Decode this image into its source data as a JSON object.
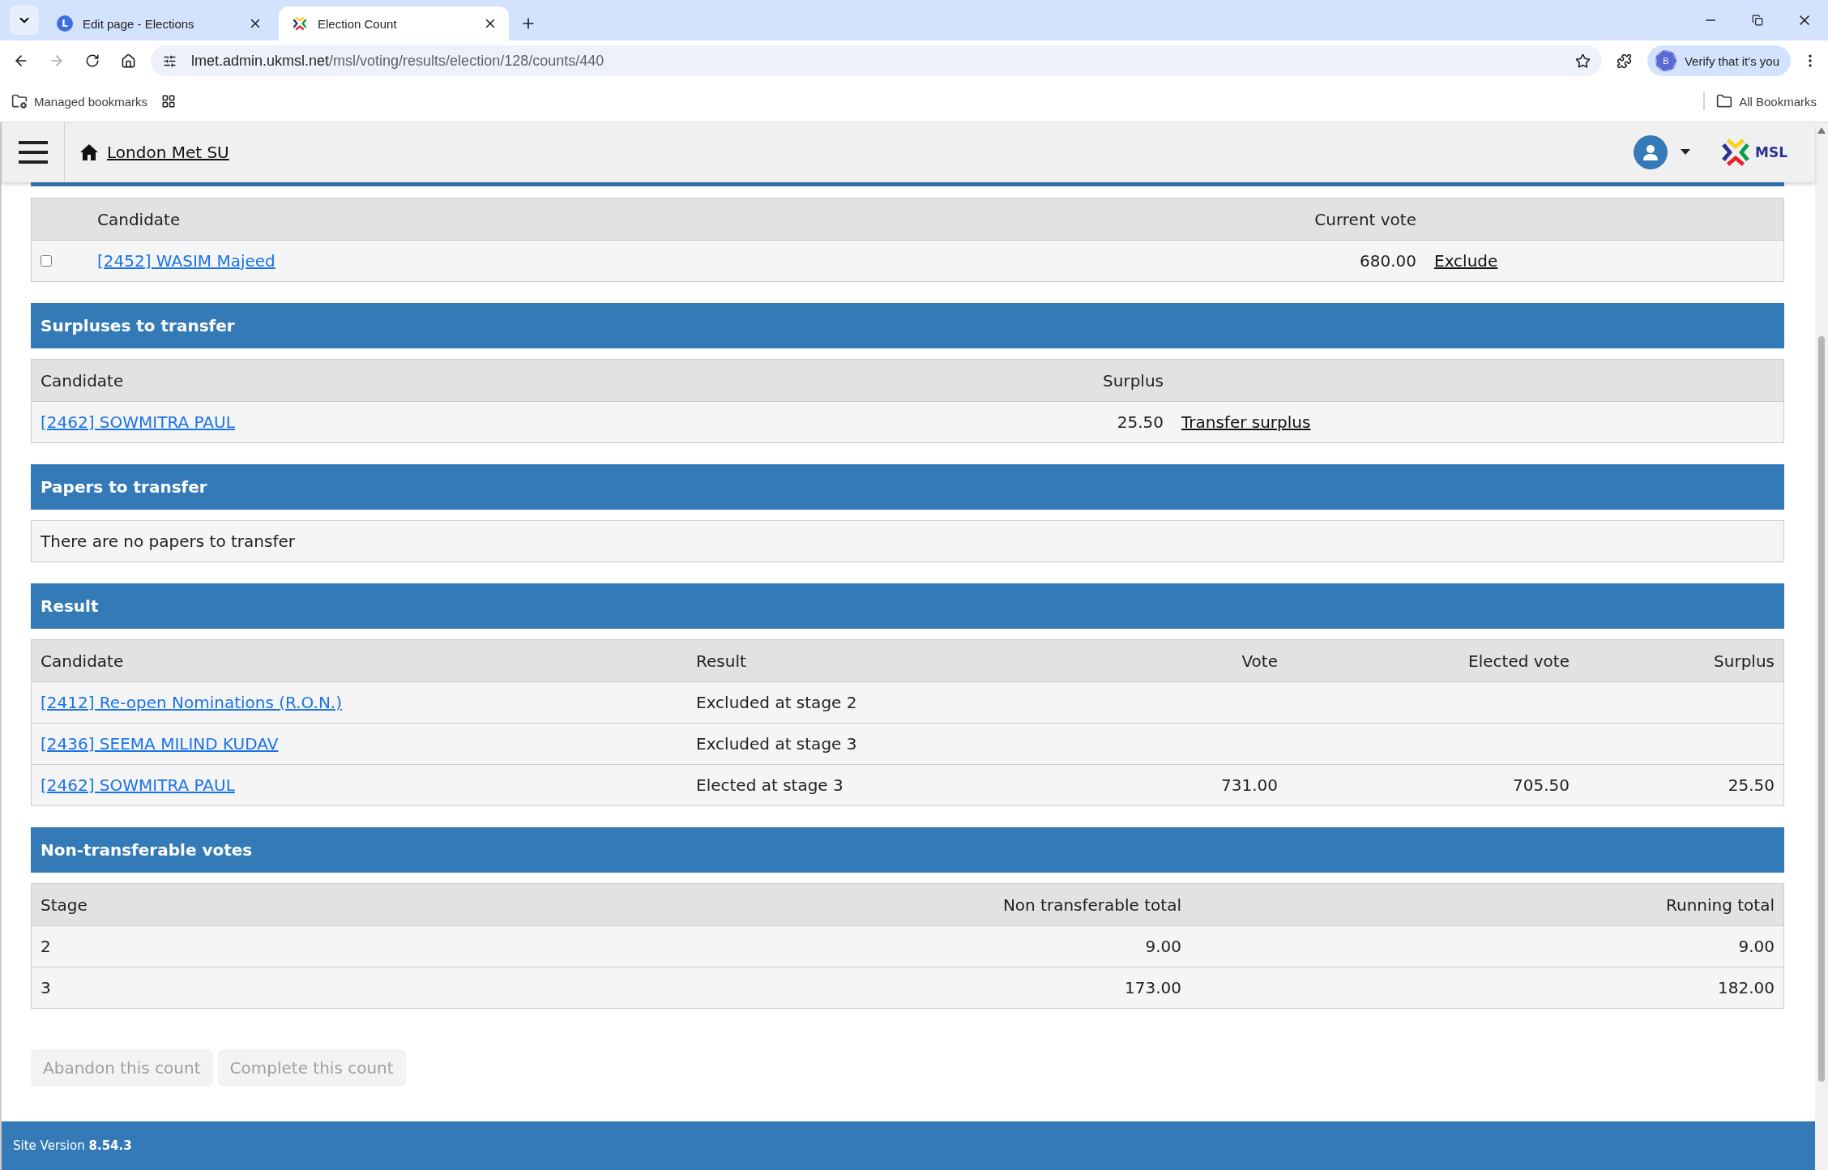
{
  "browser": {
    "tabs": [
      {
        "title": "Edit page - Elections",
        "favicon_letter": "L",
        "selected": false
      },
      {
        "title": "Election Count",
        "selected": true
      }
    ],
    "url_host": "lmet.admin.ukmsl.net",
    "url_path": "/msl/voting/results/election/128/counts/440",
    "profile_letter": "B",
    "verify_label": "Verify that it's you",
    "managed_bookmarks": "Managed bookmarks",
    "all_bookmarks": "All Bookmarks"
  },
  "header": {
    "site_name": "London Met SU",
    "logo_text": "MSL"
  },
  "exclusion": {
    "columns": [
      "Candidate",
      "Current vote"
    ],
    "rows": [
      {
        "checked": false,
        "candidate": "[2452] WASIM Majeed",
        "vote": "680.00",
        "action": "Exclude"
      }
    ]
  },
  "surpluses": {
    "title": "Surpluses to transfer",
    "columns": [
      "Candidate",
      "Surplus"
    ],
    "rows": [
      {
        "candidate": "[2462] SOWMITRA PAUL",
        "surplus": "25.50",
        "action": "Transfer surplus"
      }
    ]
  },
  "papers": {
    "title": "Papers to transfer",
    "message": "There are no papers to transfer"
  },
  "result": {
    "title": "Result",
    "columns": [
      "Candidate",
      "Result",
      "Vote",
      "Elected vote",
      "Surplus"
    ],
    "rows": [
      {
        "candidate": "[2412] Re-open Nominations (R.O.N.)",
        "result": "Excluded at stage 2"
      },
      {
        "candidate": "[2436] SEEMA MILIND KUDAV",
        "result": "Excluded at stage 3"
      },
      {
        "candidate": "[2462] SOWMITRA PAUL",
        "result": "Elected at stage 3",
        "vote": "731.00",
        "elected_vote": "705.50",
        "surplus": "25.50"
      }
    ]
  },
  "non_transferable": {
    "title": "Non-transferable votes",
    "columns": [
      "Stage",
      "Non transferable total",
      "Running total"
    ],
    "rows": [
      {
        "stage": "2",
        "total": "9.00",
        "running": "9.00"
      },
      {
        "stage": "3",
        "total": "173.00",
        "running": "182.00"
      }
    ]
  },
  "buttons": [
    {
      "label": "Abandon this count",
      "disabled": true
    },
    {
      "label": "Complete this count",
      "disabled": true
    }
  ],
  "footer": {
    "text": "Site Version **8.54.3**"
  }
}
